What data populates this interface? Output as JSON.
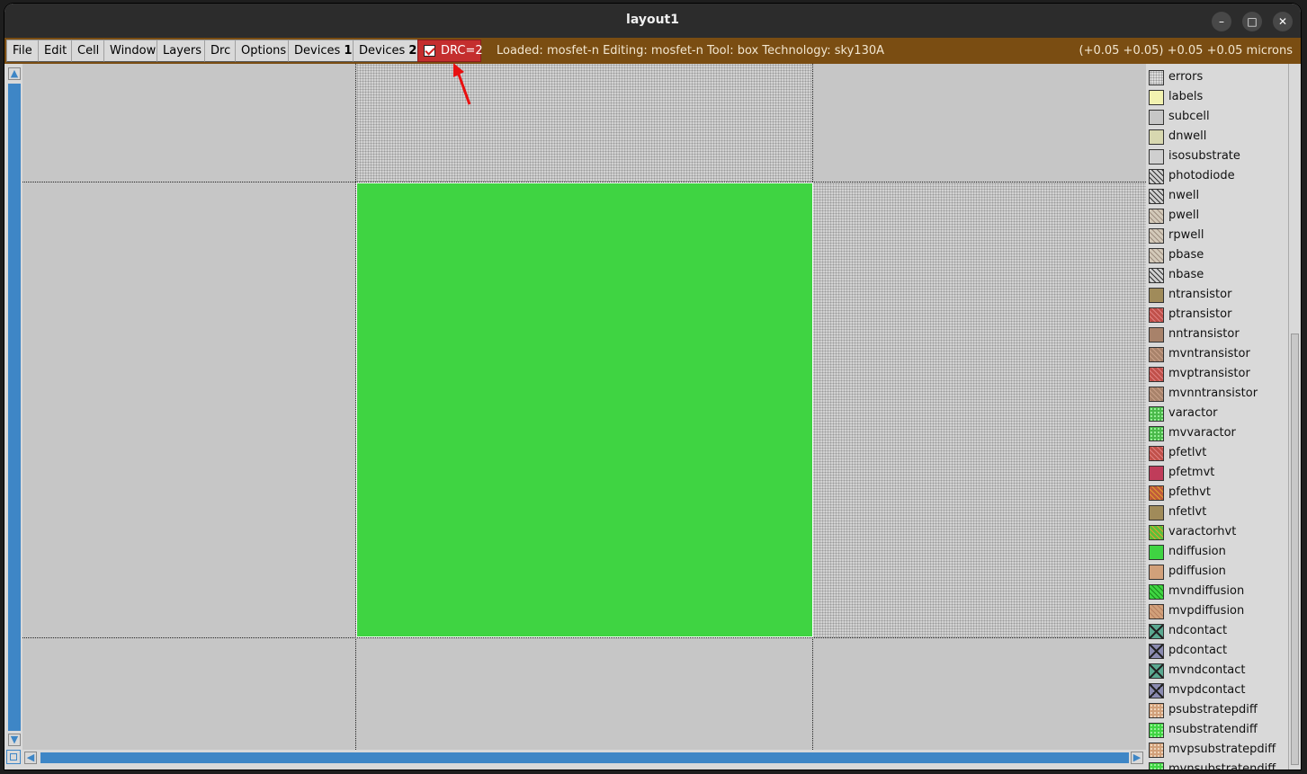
{
  "window": {
    "title": "layout1",
    "controls": {
      "minimize": "–",
      "maximize": "□",
      "close": "✕"
    }
  },
  "menubar": {
    "buttons": [
      {
        "label": "File"
      },
      {
        "label": "Edit"
      },
      {
        "label": "Cell"
      },
      {
        "label": "Window"
      },
      {
        "label": "Layers"
      },
      {
        "label": "Drc"
      },
      {
        "label": "Options"
      },
      {
        "label": "Devices ",
        "bold": "1"
      },
      {
        "label": "Devices ",
        "bold": "2"
      }
    ],
    "drc_label": "DRC=2",
    "status": "Loaded: mosfet-n Editing: mosfet-n Tool: box  Technology: sky130A",
    "coords": "(+0.05 +0.05) +0.05 +0.05 microns",
    "colors": {
      "bar": "#7a4d12",
      "drc": "#c42e2e"
    }
  },
  "canvas": {
    "box_color": "#3fd442",
    "background": "#c6c6c6"
  },
  "layers": [
    {
      "name": "errors",
      "color": "#dcdcdc",
      "pattern": "dots"
    },
    {
      "name": "labels",
      "color": "#f2f2b0",
      "pattern": "solid"
    },
    {
      "name": "subcell",
      "color": "#c6c6c6",
      "pattern": "solid"
    },
    {
      "name": "dnwell",
      "color": "#d8d8b0",
      "pattern": "solid"
    },
    {
      "name": "isosubstrate",
      "color": "#cfcfcf",
      "pattern": "solid"
    },
    {
      "name": "photodiode",
      "color": "#cfcfcf",
      "pattern": "hatch-dark"
    },
    {
      "name": "nwell",
      "color": "#cfcfcf",
      "pattern": "hatch-dark"
    },
    {
      "name": "pwell",
      "color": "#d3c9b9",
      "pattern": "hatch-light"
    },
    {
      "name": "rpwell",
      "color": "#d3c9b9",
      "pattern": "hatch-light"
    },
    {
      "name": "pbase",
      "color": "#d3c9b9",
      "pattern": "hatch-light"
    },
    {
      "name": "nbase",
      "color": "#cfcfcf",
      "pattern": "hatch-dark"
    },
    {
      "name": "ntransistor",
      "color": "#a08b5a",
      "pattern": "solid"
    },
    {
      "name": "ptransistor",
      "color": "#c0504a",
      "pattern": "hatch-red"
    },
    {
      "name": "nntransistor",
      "color": "#a8826a",
      "pattern": "solid"
    },
    {
      "name": "mvntransistor",
      "color": "#a8826a",
      "pattern": "hatch-brown"
    },
    {
      "name": "mvptransistor",
      "color": "#c0504a",
      "pattern": "hatch-red"
    },
    {
      "name": "mvnntransistor",
      "color": "#a8826a",
      "pattern": "hatch-brown"
    },
    {
      "name": "varactor",
      "color": "#4aba4a",
      "pattern": "dots-green"
    },
    {
      "name": "mvvaractor",
      "color": "#4aba4a",
      "pattern": "dots-green"
    },
    {
      "name": "pfetlvt",
      "color": "#c0504a",
      "pattern": "hatch-red"
    },
    {
      "name": "pfetmvt",
      "color": "#c03c5a",
      "pattern": "solid"
    },
    {
      "name": "pfethvt",
      "color": "#c05a3a",
      "pattern": "hatch-orange"
    },
    {
      "name": "nfetlvt",
      "color": "#a08b5a",
      "pattern": "solid"
    },
    {
      "name": "varactorhvt",
      "color": "#5ac03a",
      "pattern": "hatch-orange"
    },
    {
      "name": "ndiffusion",
      "color": "#3fd442",
      "pattern": "solid"
    },
    {
      "name": "pdiffusion",
      "color": "#d1a07a",
      "pattern": "solid"
    },
    {
      "name": "mvndiffusion",
      "color": "#3fd442",
      "pattern": "hatch-green"
    },
    {
      "name": "mvpdiffusion",
      "color": "#d1a07a",
      "pattern": "hatch-tan"
    },
    {
      "name": "ndcontact",
      "color": "#5aa890",
      "pattern": "cross"
    },
    {
      "name": "pdcontact",
      "color": "#8a8ab0",
      "pattern": "cross"
    },
    {
      "name": "mvndcontact",
      "color": "#5aa890",
      "pattern": "cross"
    },
    {
      "name": "mvpdcontact",
      "color": "#8a8ab0",
      "pattern": "cross"
    },
    {
      "name": "psubstratepdiff",
      "color": "#d1a07a",
      "pattern": "dots-tan"
    },
    {
      "name": "nsubstratendiff",
      "color": "#3fd442",
      "pattern": "dots-green"
    },
    {
      "name": "mvpsubstratepdiff",
      "color": "#d1a07a",
      "pattern": "dots-tan"
    },
    {
      "name": "mvnsubstratendiff",
      "color": "#3fd442",
      "pattern": "dots-green"
    }
  ]
}
